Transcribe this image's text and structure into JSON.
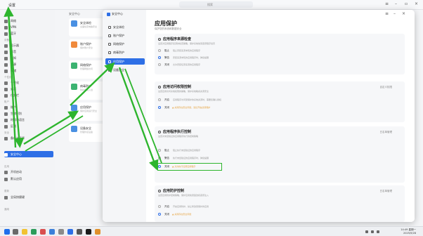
{
  "bg_window": {
    "title": "设置",
    "search_placeholder": "搜索",
    "nav": [
      {
        "label": "网络",
        "icon": "network-icon"
      },
      {
        "label": "VPN",
        "icon": "vpn-icon"
      },
      {
        "label": "蓝牙",
        "icon": "bluetooth-icon"
      },
      {
        "label": "显示器",
        "icon": "display-icon"
      },
      {
        "label": "声音",
        "icon": "sound-icon"
      },
      {
        "label": "通知",
        "icon": "notification-icon"
      },
      {
        "label": "电源",
        "icon": "power-icon"
      },
      {
        "label": "存储",
        "icon": "storage-icon"
      },
      {
        "label": "个性化",
        "icon": "personalize-icon"
      },
      {
        "label": "桌面",
        "icon": "desktop-icon"
      },
      {
        "label": "任务栏",
        "icon": "taskbar-icon"
      },
      {
        "label": "账户",
        "icon": "account-icon"
      },
      {
        "label": "生物识别",
        "icon": "biometric-icon"
      },
      {
        "label": "时间和语言",
        "icon": "time-icon"
      },
      {
        "label": "区域",
        "icon": "region-icon"
      },
      {
        "label": "备份与还原",
        "icon": "backup-icon"
      },
      {
        "label": "安全中心",
        "icon": "shield-icon"
      },
      {
        "label": "开机启动",
        "icon": "startup-icon"
      },
      {
        "label": "默认应用",
        "icon": "default-app-icon"
      },
      {
        "label": "全局快捷键",
        "icon": "keyboard-icon"
      }
    ],
    "groups": [
      "系统",
      "设备",
      "个性化",
      "账户",
      "安全",
      "应用",
      "更新",
      "通用"
    ],
    "section_title": "安全中心",
    "cards": [
      {
        "title": "安全体检",
        "sub": "全面检查电脑安全"
      },
      {
        "title": "账户保护",
        "sub": "保护账户安全"
      },
      {
        "title": "网络保护",
        "sub": "管理网络访问"
      },
      {
        "title": "病毒防护",
        "sub": "防护病毒入侵"
      },
      {
        "title": "应用保护",
        "sub": "保护应用运行安全"
      },
      {
        "title": "设备安全",
        "sub": "管理外接设备"
      }
    ]
  },
  "dialog": {
    "app_title": "安全中心",
    "nav": [
      {
        "label": "安全体检",
        "icon": "check-icon"
      },
      {
        "label": "账户保护",
        "icon": "account-shield-icon"
      },
      {
        "label": "网络保护",
        "icon": "network-shield-icon"
      },
      {
        "label": "病毒防护",
        "icon": "virus-icon"
      },
      {
        "label": "应用保护",
        "icon": "app-shield-icon"
      },
      {
        "label": "设备安全",
        "icon": "device-icon"
      }
    ],
    "page_title": "应用保护",
    "page_subtitle": "保护您的系统和数据安全",
    "sections": [
      {
        "title": "应用程序来源检查",
        "desc": "设置对应用程序来源的检查策略，保护系统免受恶意程序侵害",
        "link": "",
        "options": [
          {
            "label": "阻止",
            "desc": "阻止安装来源未知的应用程序",
            "warn": "",
            "on": false
          },
          {
            "label": "警告",
            "desc": "安装来源未知的应用程序时，弹窗提醒",
            "warn": "",
            "on": true
          },
          {
            "label": "关闭",
            "desc": "允许安装任意来源的应用程序",
            "warn": "",
            "on": false
          }
        ]
      },
      {
        "title": "应用访问权限控制",
        "desc": "设置应用访问系统权限的策略，保护系统敏感资源安全",
        "link": "自定义权限",
        "options": [
          {
            "label": "开启",
            "desc": "应用程序访问受保护的系统资源时，需要您确认授权",
            "warn": "",
            "on": false
          },
          {
            "label": "关闭",
            "desc": "",
            "warn": "关闭存在安全风险，建议开启此项保护",
            "on": true
          }
        ]
      },
      {
        "title": "应用程序执行控制",
        "desc": "设置对未经验证的应用程序执行的控制策略",
        "link": "白名单管理",
        "options": [
          {
            "label": "阻止",
            "desc": "阻止执行未经验证的应用程序",
            "warn": "",
            "on": false
          },
          {
            "label": "警告",
            "desc": "执行未经验证的应用程序时，弹窗提醒",
            "warn": "",
            "on": false
          },
          {
            "label": "关闭",
            "desc": "",
            "warn": "允许执行任意应用程序",
            "on": true
          }
        ]
      },
      {
        "title": "应用防护控制",
        "desc": "设置应用防护控制策略，保护应用免受篡改和恶意注入",
        "link": "白名单管理",
        "options": [
          {
            "label": "开启",
            "desc": "开启应用防护，禁止修改受保护的应用",
            "warn": "",
            "on": false
          },
          {
            "label": "关闭",
            "desc": "",
            "warn": "关闭存在安全风险",
            "on": true
          }
        ]
      }
    ]
  },
  "taskbar": {
    "time": "14:49 星期一",
    "date": "2025/9/28"
  },
  "colors": {
    "accent": "#2e6fe6",
    "annotation_arrow": "#2db52d",
    "warning": "#e6a23c"
  }
}
